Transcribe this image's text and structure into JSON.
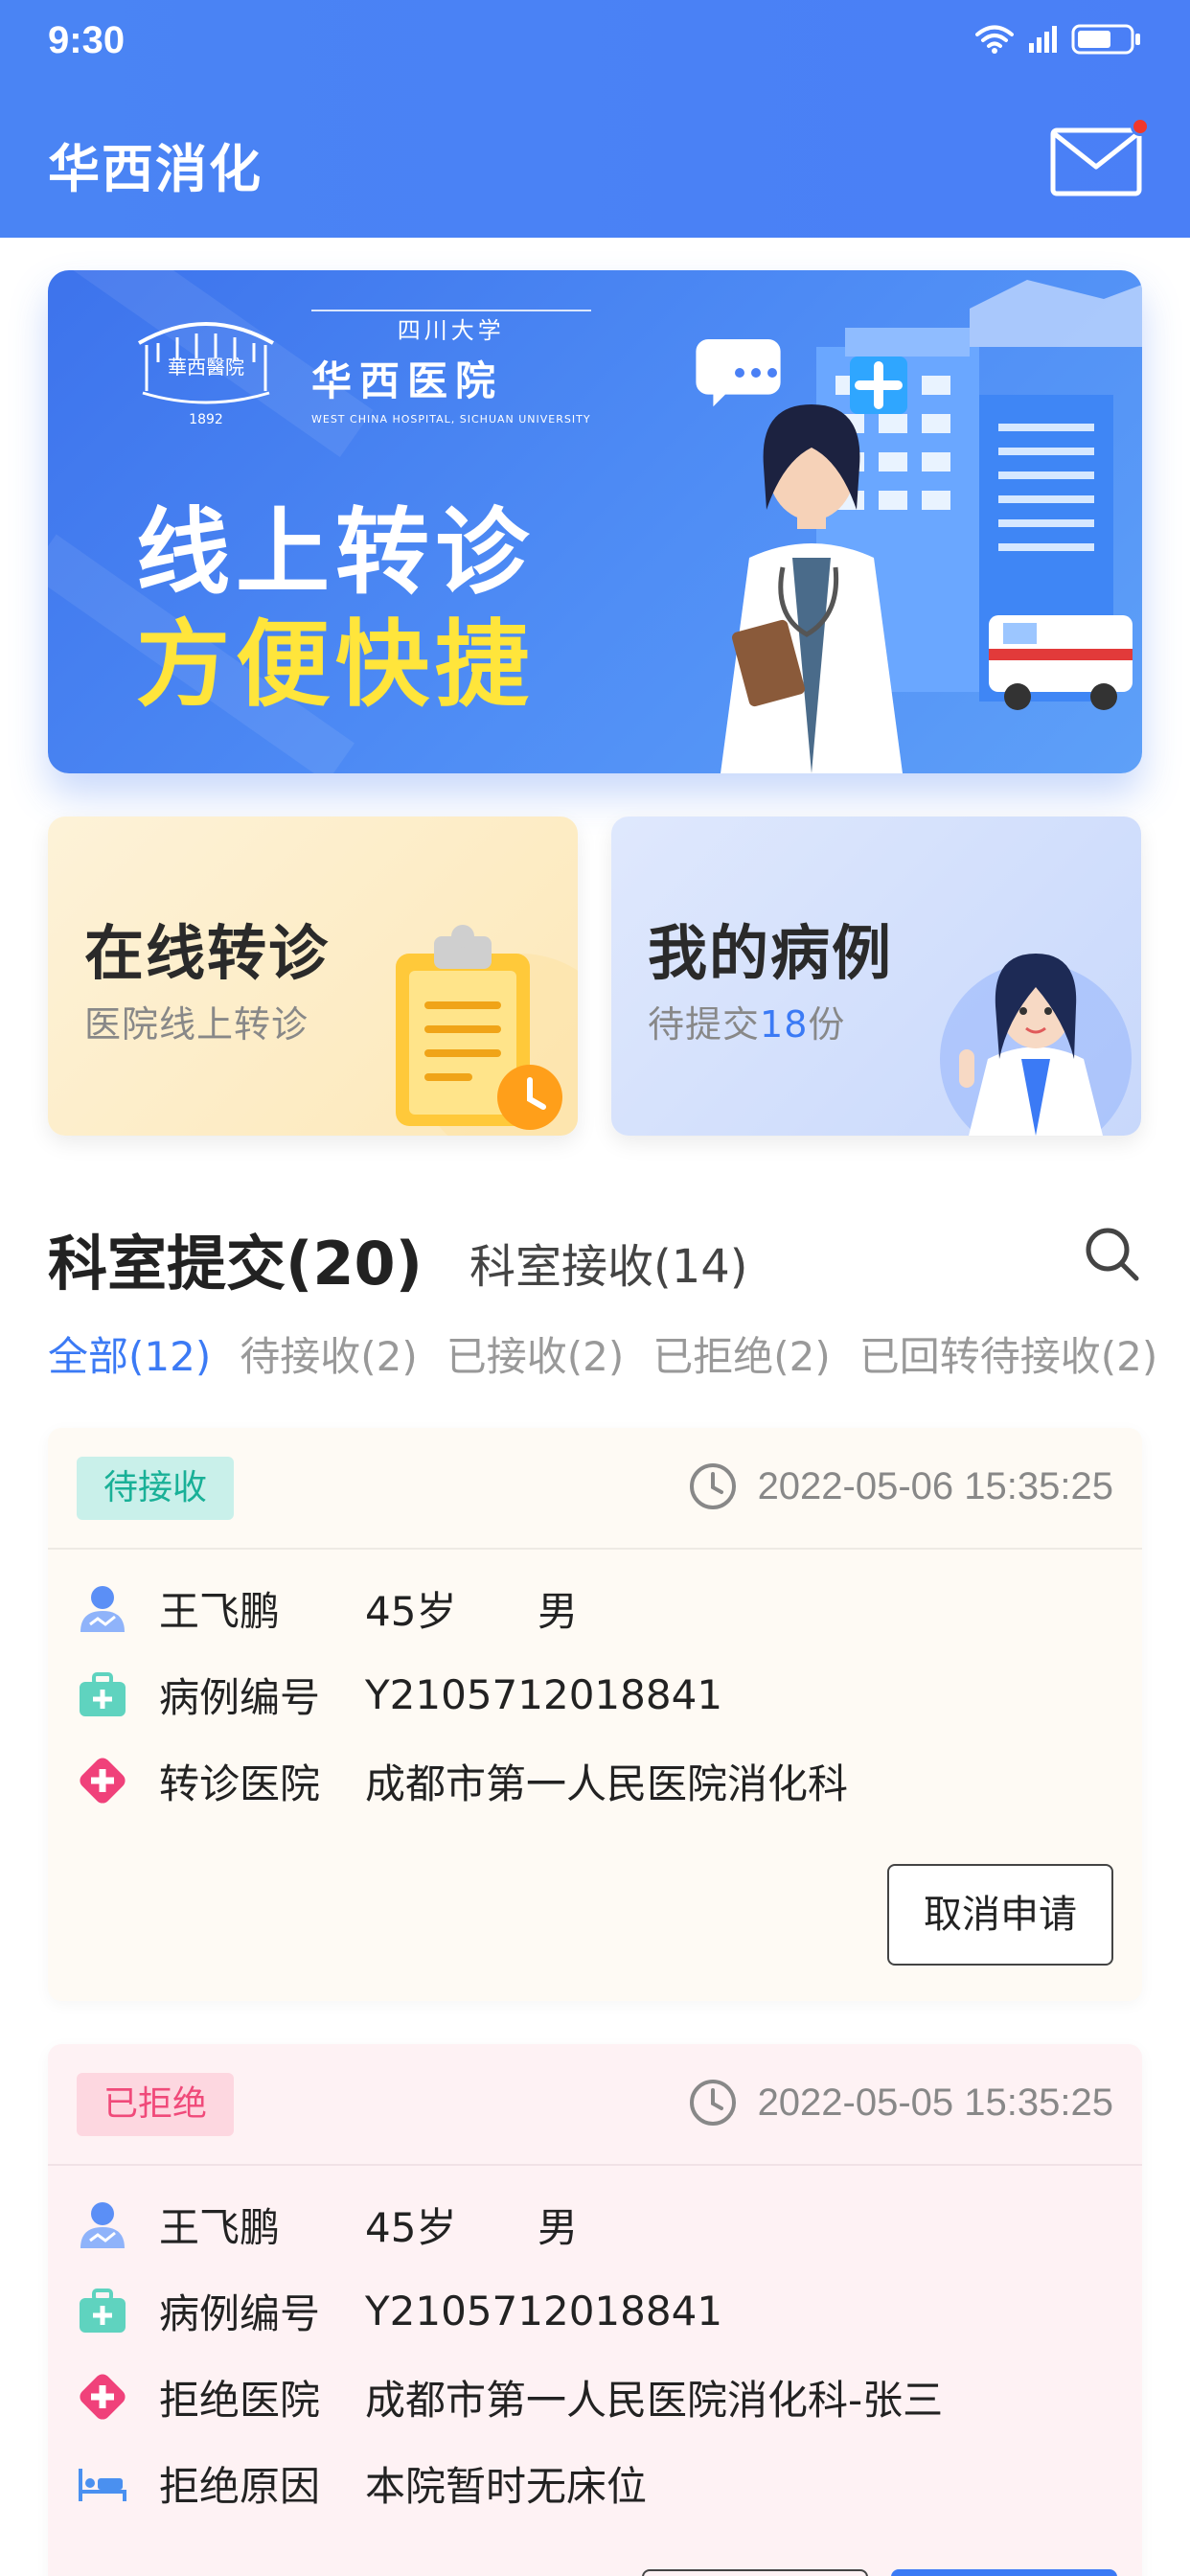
{
  "status_bar": {
    "time": "9:30"
  },
  "header": {
    "title": "华西消化"
  },
  "banner": {
    "logo_university": "四川大学",
    "logo_name": "华西医院",
    "logo_english": "WEST CHINA HOSPITAL, SICHUAN UNIVERSITY",
    "logo_seal_text": "華西醫院",
    "logo_year": "1892",
    "line1": "线上转诊",
    "line2": "方便快捷"
  },
  "features": [
    {
      "title": "在线转诊",
      "subtitle": "医院线上转诊"
    },
    {
      "title": "我的病例",
      "subtitle_prefix": "待提交",
      "subtitle_count": "18",
      "subtitle_suffix": "份"
    }
  ],
  "tabs": {
    "active": "科室提交(20)",
    "inactive": "科室接收(14)"
  },
  "filters": [
    "全部(12)",
    "待接收(2)",
    "已接收(2)",
    "已拒绝(2)",
    "已回转待接收(2)"
  ],
  "records": [
    {
      "status": "待接收",
      "time": "2022-05-06 15:35:25",
      "name": "王飞鹏",
      "age": "45岁",
      "gender": "男",
      "case_label": "病例编号",
      "case_no": "Y2105712018841",
      "hospital_label": "转诊医院",
      "hospital": "成都市第一人民医院消化科",
      "action": "取消申请"
    },
    {
      "status": "已拒绝",
      "time": "2022-05-05 15:35:25",
      "name": "王飞鹏",
      "age": "45岁",
      "gender": "男",
      "case_label": "病例编号",
      "case_no": "Y2105712018841",
      "hospital_label": "拒绝医院",
      "hospital": "成都市第一人民医院消化科-张三",
      "reason_label": "拒绝原因",
      "reason": "本院暂时无床位"
    }
  ],
  "colors": {
    "primary": "#4a80f5",
    "accent_yellow": "#ffe53b",
    "pending_text": "#19b097",
    "rejected_text": "#f04a7a",
    "unread_dot": "#f0382b"
  },
  "icons": [
    "wifi-icon",
    "signal-icon",
    "battery-icon",
    "mail-icon",
    "search-icon",
    "clock-icon",
    "user-icon",
    "medical-kit-icon",
    "hospital-cross-icon",
    "bed-icon",
    "clipboard-icon"
  ]
}
